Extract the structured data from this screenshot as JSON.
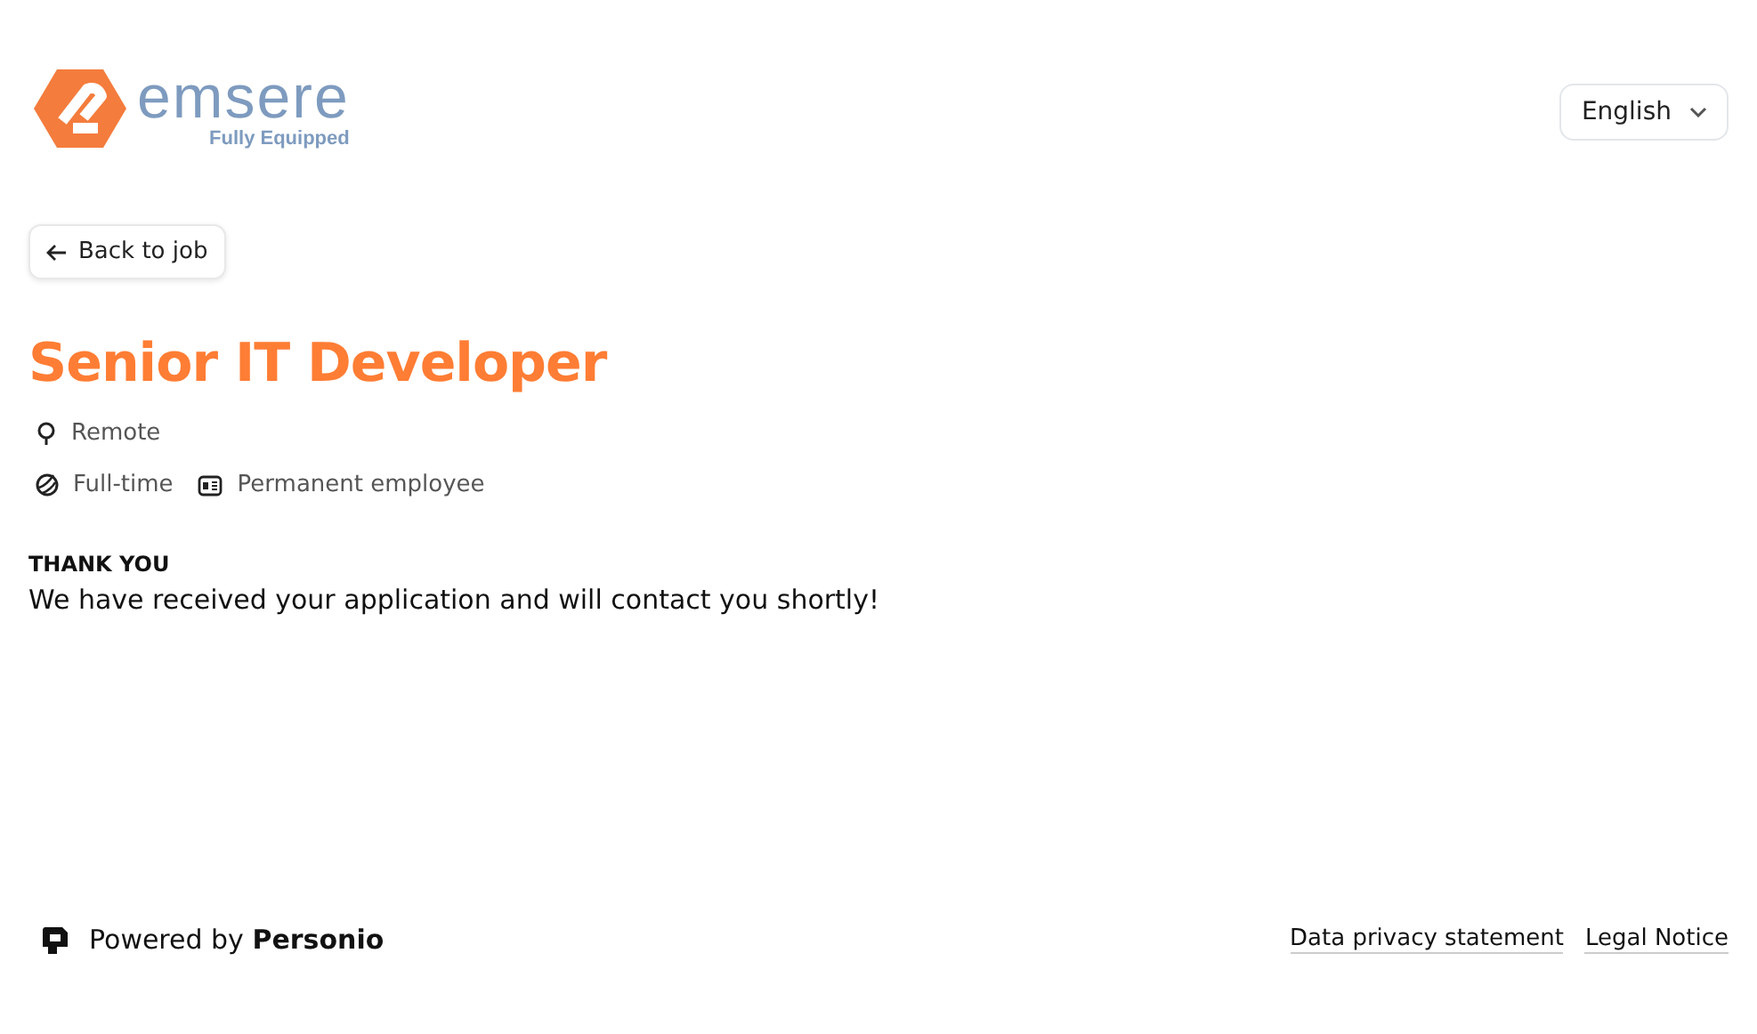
{
  "logo": {
    "name": "emsere",
    "tagline": "Fully Equipped"
  },
  "language": {
    "label": "English"
  },
  "back_button": {
    "label": "Back to job"
  },
  "job": {
    "title": "Senior IT Developer",
    "details": [
      [
        {
          "kind": "location",
          "text": "Remote"
        }
      ],
      [
        {
          "kind": "schedule",
          "text": "Full-time"
        },
        {
          "kind": "contract",
          "text": "Permanent employee"
        }
      ]
    ]
  },
  "confirmation": {
    "heading": "THANK YOU",
    "message": "We have received your application and will contact you shortly!"
  },
  "footer": {
    "powered_by": "Powered by **Personio**",
    "links": [
      "Data privacy statement",
      "Legal Notice"
    ]
  }
}
